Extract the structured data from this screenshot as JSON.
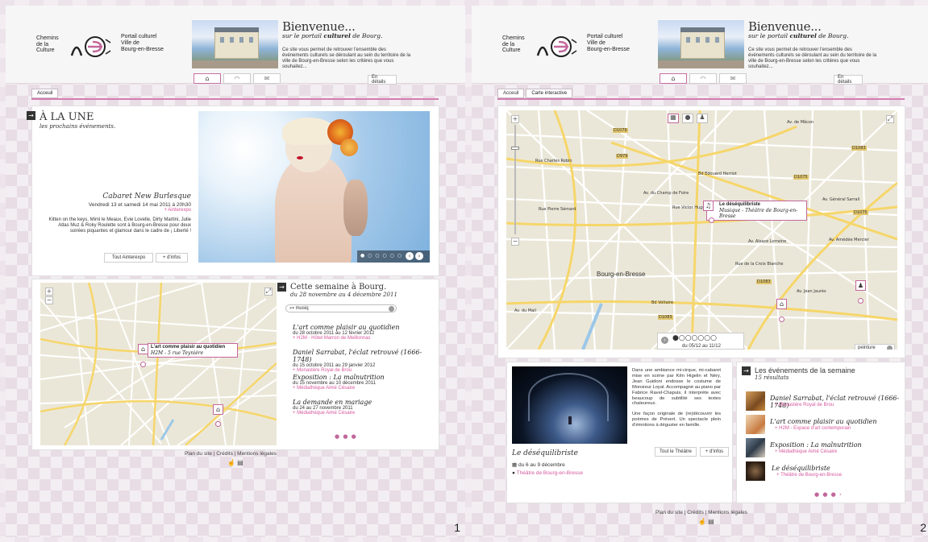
{
  "header": {
    "logo_text": "Chemins\nde la\nCulture",
    "portal_text": "Portail culturel\nVille de\nBourg-en-Bresse",
    "title": "Bienvenue...",
    "subtitle_pre": "sur le portail ",
    "subtitle_bold": "culturel",
    "subtitle_post": " de Bourg.",
    "description": "Ce site vous permet de retrouver l'ensemble des événements culturels se déroulant au sein du territoire de la ville de Bourg-en-Bresse selon les critères que vous souhaitez...",
    "details_button": "En détails",
    "icons": [
      "home-icon",
      "wifi-icon",
      "mail-icon"
    ]
  },
  "screen1": {
    "number": "1",
    "breadcrumbs": [
      "Acceuil"
    ],
    "une": {
      "title": "À LA UNE",
      "subtitle": "les prochains événements.",
      "event_title": "Cabaret New Burlesque",
      "event_date": "Vendredi 13 et samedi 14 mai 2011 à 20h30",
      "event_place": "+ Ainterexpo",
      "event_desc": "Kitten on the keys, Mimi le Meaux, Evie Lovelle, Dirty Martini, Julie Atlas Muz & Roky Roulette sont à Bourg-en-Bresse pour deux soirées piquantes et glamour dans le cadre de ¡ Liberté !",
      "btn_all": "Tout Ainterexpo",
      "btn_more": "+ d'infos",
      "slider_dots": "● ○ ○ ○ ○ ○"
    },
    "map_tip_title": "L'art comme plaisir au quotidien",
    "map_tip_sub": "H2M - 5 rue Teynière",
    "week": {
      "title": "Cette semaine à Bourg.",
      "subtitle": "du 28 novembre au 4 décembre 2011",
      "search_value": "musiq",
      "events": [
        {
          "title": "L'art comme plaisir au quotidien",
          "date": "du 28 octobre 2011 au 12 février 2012",
          "place": "+ H2M - Hôtel Marron de Meillonnas"
        },
        {
          "title": "Daniel Sarrabat, l'éclat retrouvé (1666-1748)",
          "date": "du 15 octobre 2011 au 29 janvier 2012",
          "place": "+ Monastère Royal de Brou"
        },
        {
          "title": "Exposition : La malnutrition",
          "date": "du 15 novembre au 10 décembre 2011",
          "place": "+ Médiathèque Aimé Césaire"
        },
        {
          "title": "La demande en mariage",
          "date": "du 24 au 27 novembre 2011",
          "place": "+ Médiathèque Aimé Césaire"
        }
      ],
      "pager": "● ● ●"
    },
    "footer": "Plan du site | Crédits | Mentions légales"
  },
  "screen2": {
    "number": "2",
    "breadcrumbs": [
      "Acceuil",
      "Carte interactive"
    ],
    "map": {
      "city_label": "Bourg-en-Bresse",
      "tip_title": "Le déséquilibriste",
      "tip_sub": "Musique - Théâtre de Bourg-en-Bresse",
      "date_range": "du 05/12 au 11/12",
      "filter_label": "peinture",
      "streets": [
        "D1079",
        "D1083",
        "D1075",
        "D1083",
        "Bd Edouard Herriot",
        "Av. de Mâcon",
        "Rue Victor Hugo",
        "Av. Amédée Mercier",
        "Rue Charles Robin",
        "Av. Jean Jaurès",
        "Av. Alsace Lorraine",
        "Bd Voltaire",
        "Av. du Mail",
        "Rue Pierre Sémard",
        "Rue de la Croix Blanche",
        "Av. Général Sarrail",
        "Av. du Champ de Foire",
        "D1083",
        "D979",
        "D1075"
      ]
    },
    "featured": {
      "desc1": "Dans une ambiance mi-cirque, mi-cabaret mise en scène par Kên Higelin et Néry, Jean Guidoni endosse le costume de Monsieur Loyal. Accompagné au piano par Fabrice Ravel-Chapuis, il interprète avec beaucoup de subtilité ses textes chaleureux.",
      "desc2": "Une façon originale de (re)découvrir les poèmes de Prévert. Un spectacle plein d'émotions à déguster en famille.",
      "btn_all": "Tout le Théâtre",
      "btn_more": "+ d'infos",
      "title": "Le déséquilibriste",
      "date": "du 6 au 9 décembre",
      "place": "Théâtre de Bourg-en-Bresse"
    },
    "week": {
      "title": "Les événements de la semaine",
      "subtitle": "15 résultats",
      "events": [
        {
          "title": "Daniel Sarrabat, l'éclat retrouvé (1666-1748)",
          "place": "+ Monastère Royal de Brou"
        },
        {
          "title": "L'art comme plaisir au quotidien",
          "place": "+ H2M - Espace d'art contemporain"
        },
        {
          "title": "Exposition : La malnutrition",
          "place": "+ Médiathèque Aimé Césaire"
        },
        {
          "title": "Le déséquilibriste",
          "place": "+ Théâtre de Bourg-en-Bresse"
        }
      ],
      "pager": "● ● ● ›"
    },
    "footer": "Plan du site | Crédits | Mentions légales"
  },
  "colors": {
    "accent": "#d6579d",
    "border_pink": "#c2679b"
  }
}
